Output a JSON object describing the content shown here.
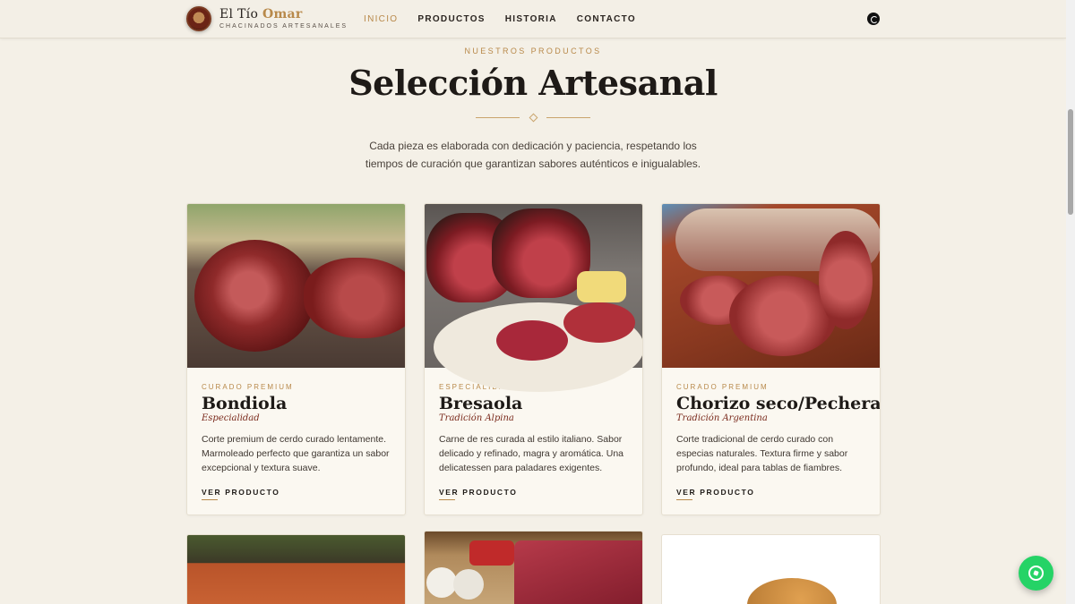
{
  "header": {
    "brand_main": "El Tío ",
    "brand_accent": "Omar",
    "brand_tag": "CHACINADOS ARTESANALES",
    "nav": [
      "INICIO",
      "PRODUCTOS",
      "HISTORIA",
      "CONTACTO"
    ],
    "active_nav": "INICIO"
  },
  "intro": {
    "eyebrow": "NUESTROS PRODUCTOS",
    "title": "Selección Artesanal",
    "lead": "Cada pieza es elaborada con dedicación y paciencia, respetando los tiempos de curación que garantizan sabores auténticos e inigualables."
  },
  "products": [
    {
      "category": "CURADO PREMIUM",
      "name": "Bondiola",
      "subtitle": "Especialidad",
      "description": "Corte premium de cerdo curado lentamente. Marmoleado perfecto que garantiza un sabor excepcional y textura suave.",
      "cta": "VER PRODUCTO"
    },
    {
      "category": "ESPECIALIDAD",
      "name": "Bresaola",
      "subtitle": "Tradición Alpina",
      "description": "Carne de res curada al estilo italiano. Sabor delicado y refinado, magra y aromática. Una delicatessen para paladares exigentes.",
      "cta": "VER PRODUCTO"
    },
    {
      "category": "CURADO PREMIUM",
      "name": "Chorizo seco/Pechera",
      "subtitle": "Tradición Argentina",
      "description": "Corte tradicional de cerdo curado con especias naturales. Textura firme y sabor profundo, ideal para tablas de fiambres.",
      "cta": "VER PRODUCTO"
    }
  ],
  "icons": {
    "header_whatsapp": "whatsapp-icon",
    "floating_whatsapp": "whatsapp-icon"
  },
  "colors": {
    "accent": "#b8894a",
    "background": "#f4f0e7",
    "whatsapp": "#25d366"
  }
}
